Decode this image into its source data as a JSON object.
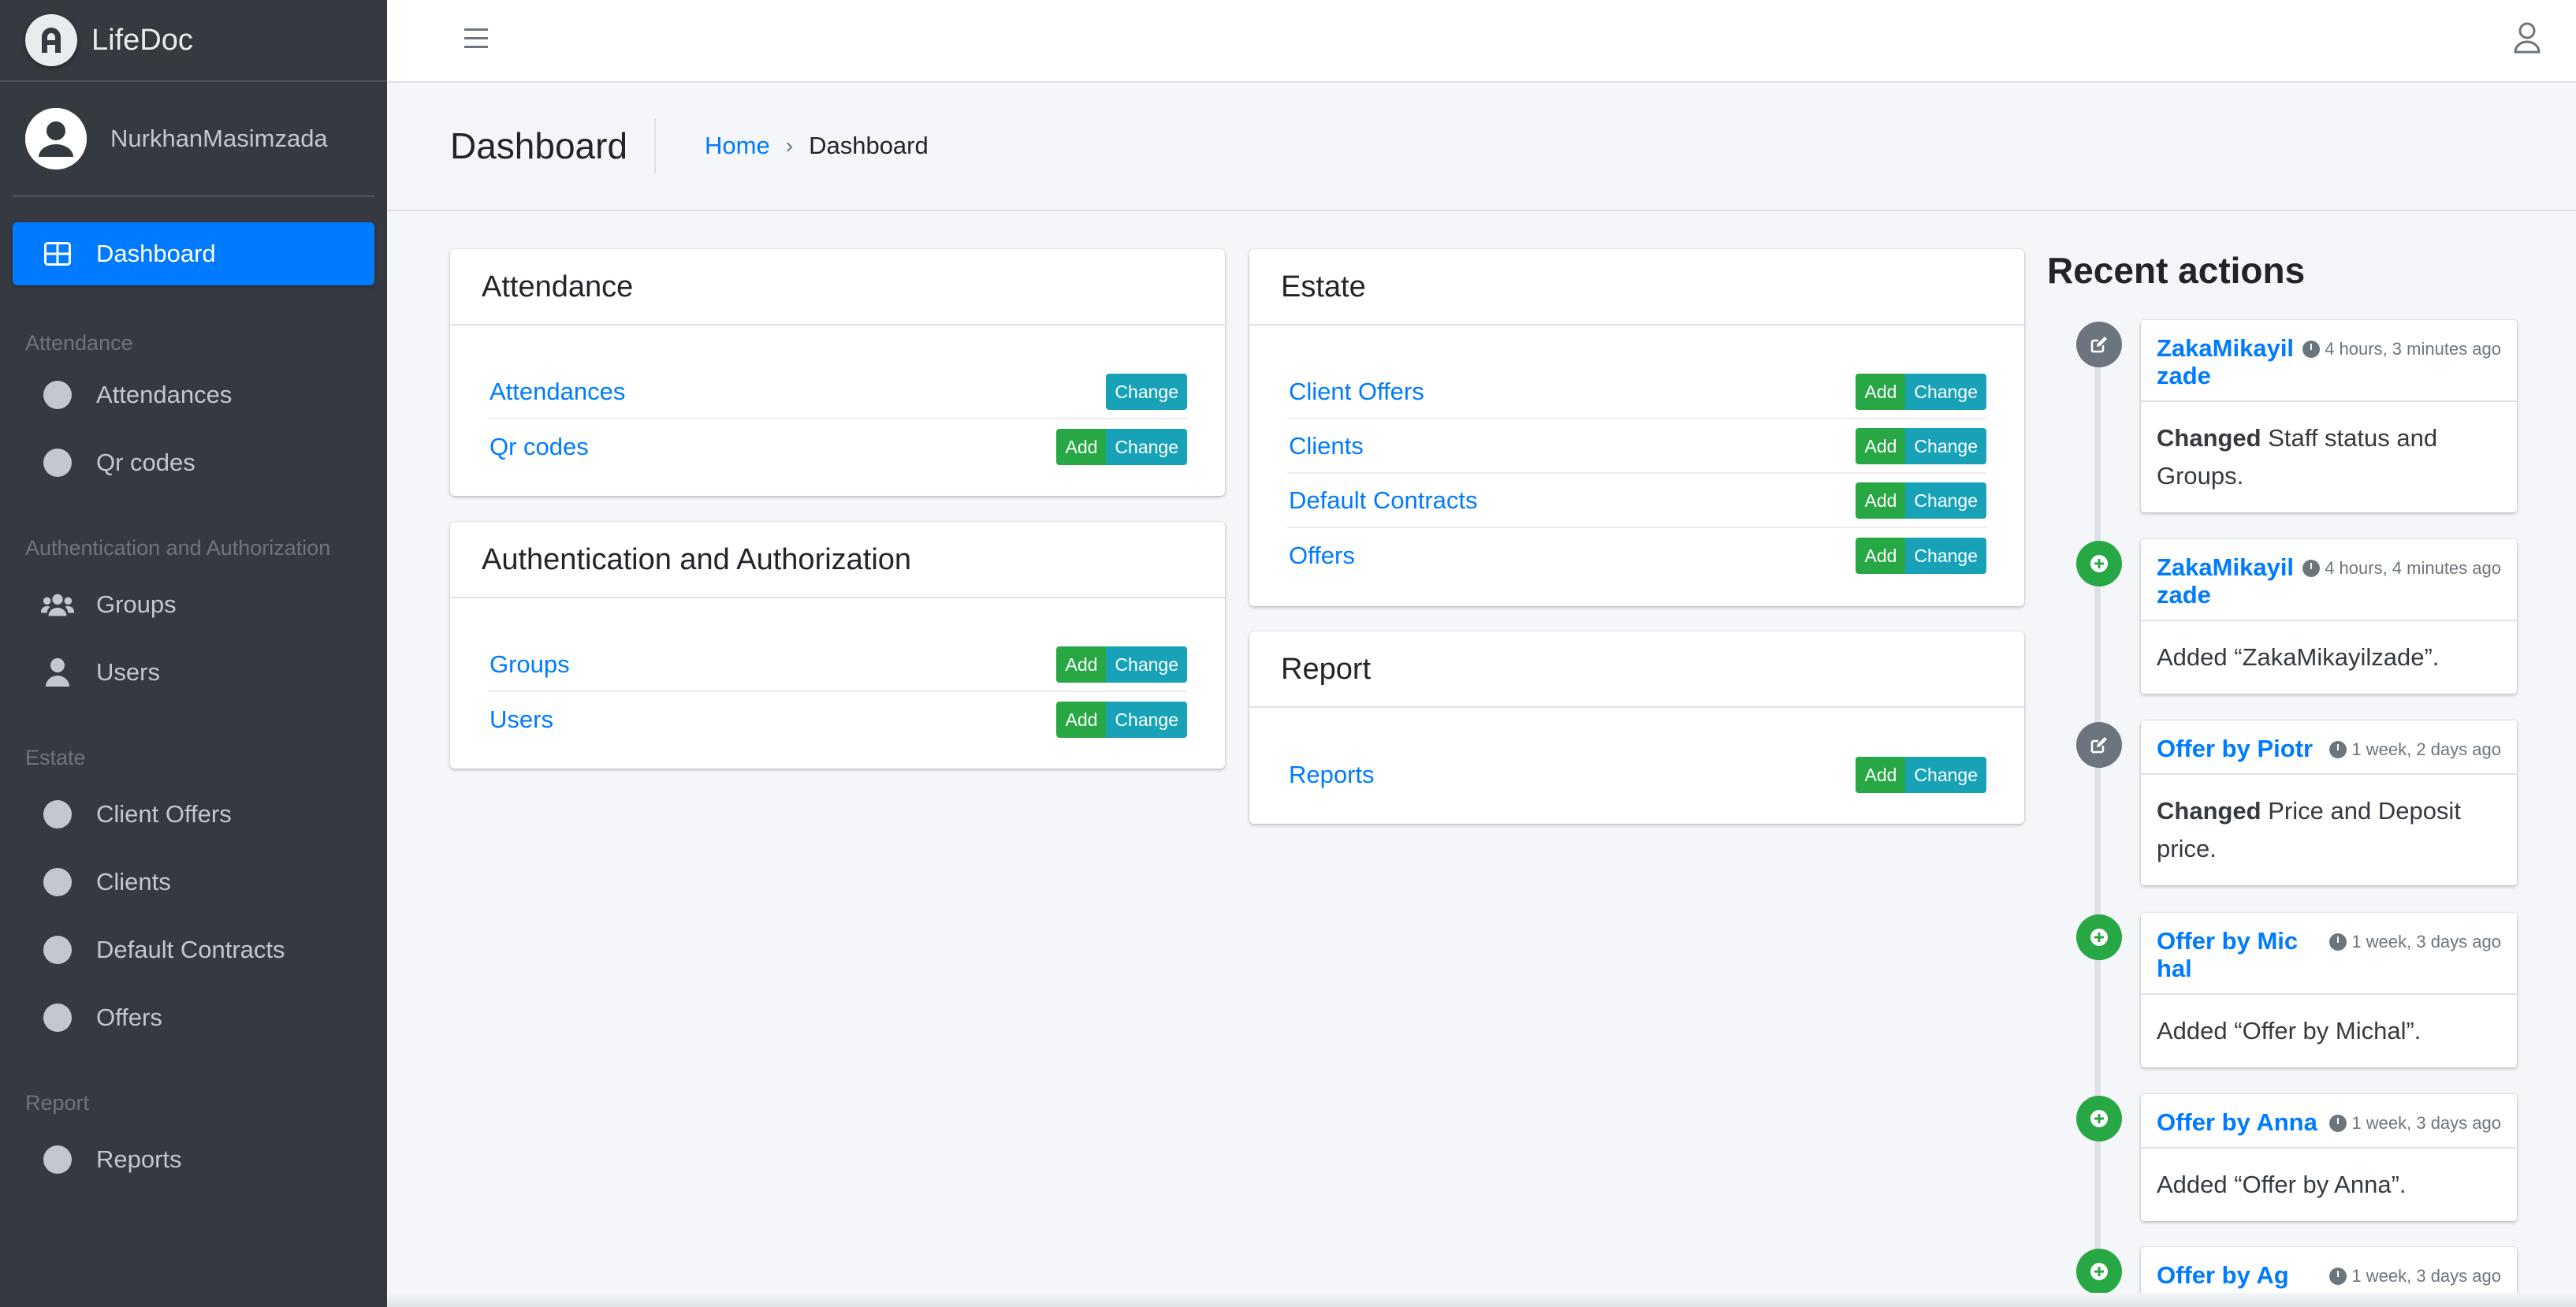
{
  "brand": {
    "title": "LifeDoc",
    "logo_icon": "lifedoc-logo"
  },
  "user": {
    "name": "NurkhanMasimzada",
    "avatar_icon": "user-circle-icon"
  },
  "sidebar": {
    "dashboard": {
      "label": "Dashboard",
      "icon": "table-icon"
    },
    "sections": [
      {
        "header": "Attendance",
        "items": [
          {
            "label": "Attendances"
          },
          {
            "label": "Qr codes"
          }
        ]
      },
      {
        "header": "Authentication and Authorization",
        "items": [
          {
            "label": "Groups",
            "icon": "users-icon"
          },
          {
            "label": "Users",
            "icon": "user-icon"
          }
        ]
      },
      {
        "header": "Estate",
        "items": [
          {
            "label": "Client Offers"
          },
          {
            "label": "Clients"
          },
          {
            "label": "Default Contracts"
          },
          {
            "label": "Offers"
          }
        ]
      },
      {
        "header": "Report",
        "items": [
          {
            "label": "Reports"
          }
        ]
      }
    ]
  },
  "topbar": {
    "menu_icon": "hamburger-icon",
    "user_icon": "user-outline-icon"
  },
  "header": {
    "title": "Dashboard",
    "breadcrumb": {
      "home": "Home",
      "current": "Dashboard"
    }
  },
  "buttons": {
    "add": "Add",
    "change": "Change"
  },
  "cards": {
    "attendance": {
      "title": "Attendance",
      "rows": [
        {
          "label": "Attendances"
        },
        {
          "label": "Qr codes"
        }
      ]
    },
    "auth": {
      "title": "Authentication and Authorization",
      "rows": [
        {
          "label": "Groups"
        },
        {
          "label": "Users"
        }
      ]
    },
    "estate": {
      "title": "Estate",
      "rows": [
        {
          "label": "Client Offers"
        },
        {
          "label": "Clients"
        },
        {
          "label": "Default Contracts"
        },
        {
          "label": "Offers"
        }
      ]
    },
    "report": {
      "title": "Report",
      "rows": [
        {
          "label": "Reports"
        }
      ]
    }
  },
  "recent_actions": {
    "title": "Recent actions",
    "items": [
      {
        "type": "change",
        "name": "ZakaMikayilzade",
        "time": "4 hours, 3 minutes ago",
        "verb": "Changed",
        "text": "Staff status and Groups."
      },
      {
        "type": "add",
        "name": "ZakaMikayilzade",
        "time": "4 hours, 4 minutes ago",
        "text": "Added “ZakaMikayilzade”."
      },
      {
        "type": "change",
        "name": "Offer by Piotr",
        "time": "1 week, 2 days ago",
        "verb": "Changed",
        "text": "Price and Deposit price."
      },
      {
        "type": "add",
        "name": "Offer by Michal",
        "time": "1 week, 3 days ago",
        "text": "Added “Offer by Michal”."
      },
      {
        "type": "add",
        "name": "Offer by Anna",
        "time": "1 week, 3 days ago",
        "text": "Added “Offer by Anna”."
      },
      {
        "type": "add",
        "name": "Offer by Agnieszka",
        "time": "1 week, 3 days ago"
      }
    ]
  },
  "colors": {
    "sidebar_bg": "#343a40",
    "primary": "#007bff",
    "add": "#28a745",
    "change": "#17a2b8",
    "muted": "#6c757d"
  }
}
